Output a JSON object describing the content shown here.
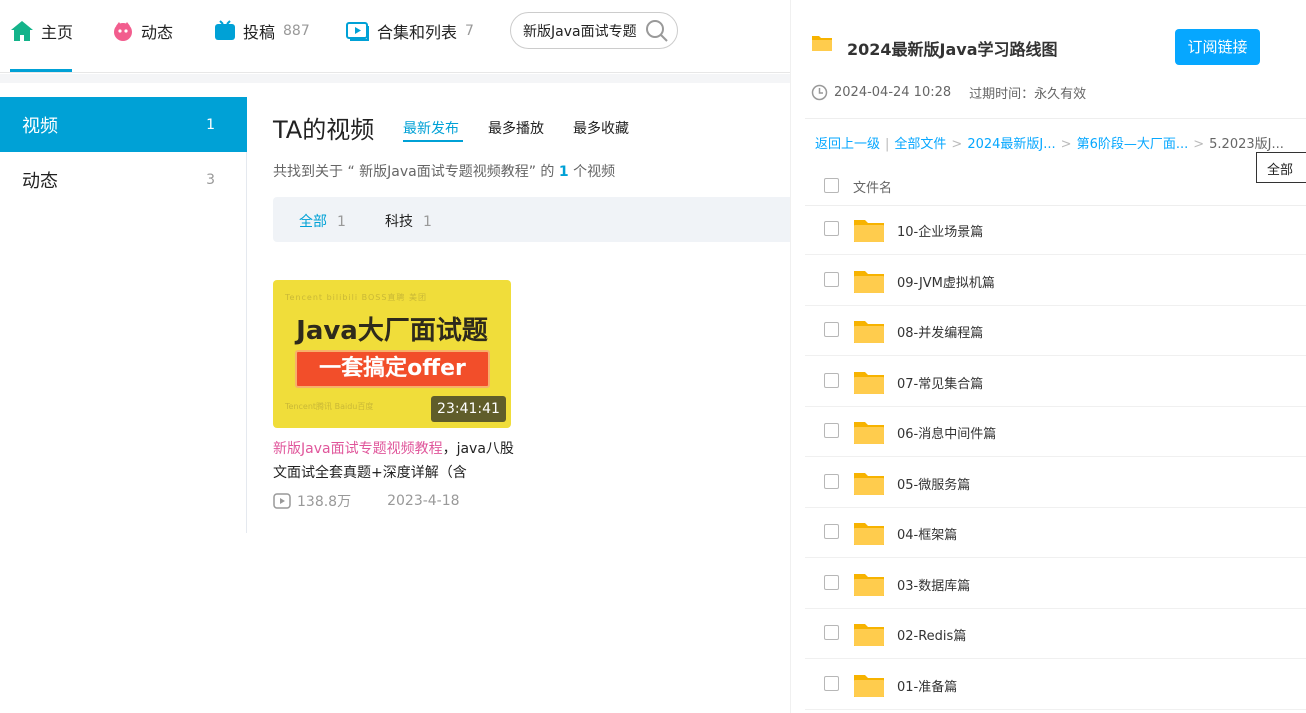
{
  "nav": {
    "home": "主页",
    "dynamic": "动态",
    "posts": "投稿",
    "posts_count": "887",
    "collections": "合集和列表",
    "collections_count": "7",
    "search_value": "新版Java面试专题"
  },
  "sidebar": {
    "items": [
      {
        "label": "视频",
        "count": "1"
      },
      {
        "label": "动态",
        "count": "3"
      }
    ]
  },
  "main": {
    "title": "TA的视频",
    "tabs": [
      "最新发布",
      "最多播放",
      "最多收藏"
    ],
    "found_prefix": "共找到关于 “ 新版Java面试专题视频教程” 的 ",
    "found_count": "1",
    "found_suffix": " 个视频",
    "filters": [
      {
        "label": "全部",
        "count": "1"
      },
      {
        "label": "科技",
        "count": "1"
      }
    ]
  },
  "video": {
    "thumb_top": "Tencent  bilibili  BOSS直聘  美团",
    "thumb_title": "Java大厂面试题",
    "thumb_ribbon": "一套搞定offer",
    "thumb_bottom": "Tencent腾讯     Baidu百度",
    "duration": "23:41:41",
    "title_highlight": "新版Java面试专题视频教程",
    "title_rest": "，java八股文面试全套真题+深度详解（含",
    "plays": "138.8万",
    "date": "2023-4-18"
  },
  "panel": {
    "title": "2024最新版Java学习路线图",
    "subscribe": "订阅链接",
    "created": "2024-04-24 10:28",
    "expiry": "过期时间：永久有效",
    "breadcrumb": [
      "返回上一级",
      "全部文件",
      "2024最新版J...",
      "第6阶段—大厂面...",
      "5.2023版J..."
    ],
    "tooltip": "全部",
    "header_label": "文件名",
    "files": [
      "10-企业场景篇",
      "09-JVM虚拟机篇",
      "08-并发编程篇",
      "07-常见集合篇",
      "06-消息中间件篇",
      "05-微服务篇",
      "04-框架篇",
      "03-数据库篇",
      "02-Redis篇",
      "01-准备篇"
    ]
  },
  "colors": {
    "accent": "#00a1d6",
    "panel_accent": "#06a7ff",
    "highlight_pink": "#e0569b",
    "folder": "#ffcc4d"
  }
}
